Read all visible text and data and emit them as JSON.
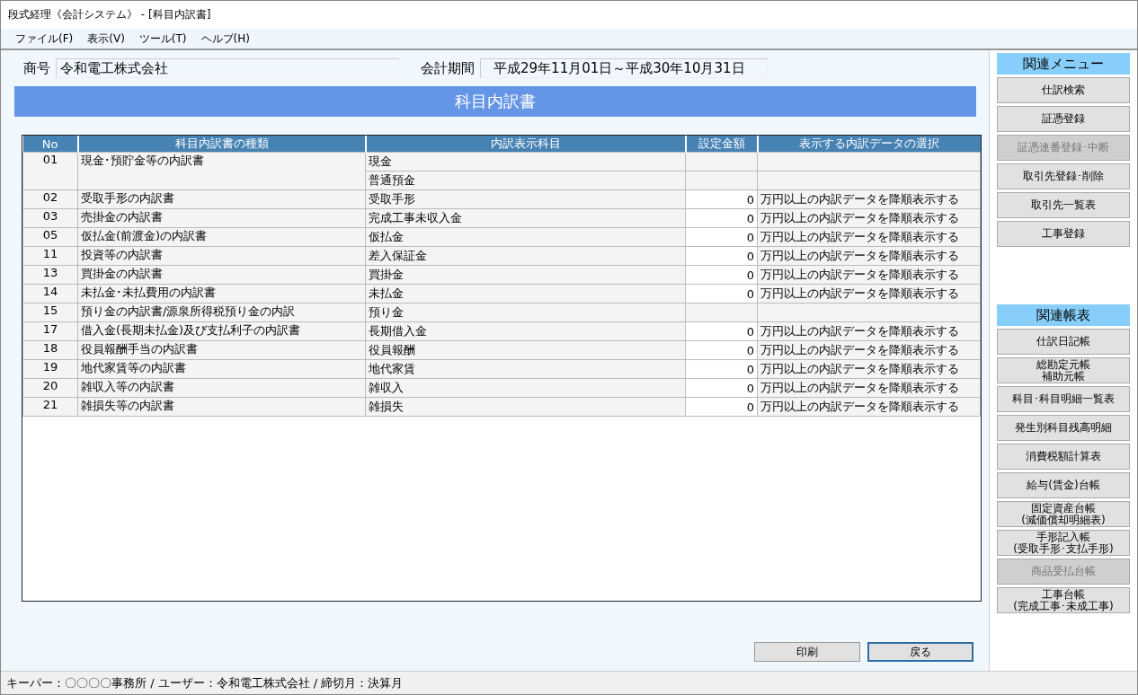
{
  "window": {
    "title": "段式経理《会計システム》 - [科目内訳書]"
  },
  "menu": [
    {
      "label": "ファイル(F)"
    },
    {
      "label": "表示(V)"
    },
    {
      "label": "ツール(T)"
    },
    {
      "label": "ヘルプ(H)"
    }
  ],
  "header": {
    "company_label": "商号",
    "company": "令和電工株式会社",
    "period_label": "会計期間",
    "period": "平成29年11月01日～平成30年10月31日"
  },
  "page_title": "科目内訳書",
  "table": {
    "columns": [
      "No",
      "科目内訳書の種類",
      "内訳表示科目",
      "設定金額",
      "表示する内訳データの選択"
    ],
    "rows": [
      {
        "no": "01",
        "statement": "現金･預貯金等の内訳書",
        "lines": [
          {
            "subject": "現金"
          },
          {
            "subject": "普通預金"
          }
        ]
      },
      {
        "no": "02",
        "statement": "受取手形の内訳書",
        "lines": [
          {
            "subject": "受取手形",
            "amount": "0",
            "selection": "万円以上の内訳データを降順表示する"
          }
        ]
      },
      {
        "no": "03",
        "statement": "売掛金の内訳書",
        "lines": [
          {
            "subject": "完成工事未収入金",
            "amount": "0",
            "selection": "万円以上の内訳データを降順表示する"
          }
        ]
      },
      {
        "no": "05",
        "statement": "仮払金(前渡金)の内訳書",
        "lines": [
          {
            "subject": "仮払金",
            "amount": "0",
            "selection": "万円以上の内訳データを降順表示する"
          }
        ]
      },
      {
        "no": "11",
        "statement": "投資等の内訳書",
        "lines": [
          {
            "subject": "差入保証金",
            "amount": "0",
            "selection": "万円以上の内訳データを降順表示する"
          }
        ]
      },
      {
        "no": "13",
        "statement": "買掛金の内訳書",
        "lines": [
          {
            "subject": "買掛金",
            "amount": "0",
            "selection": "万円以上の内訳データを降順表示する"
          }
        ]
      },
      {
        "no": "14",
        "statement": "未払金･未払費用の内訳書",
        "lines": [
          {
            "subject": "未払金",
            "amount": "0",
            "selection": "万円以上の内訳データを降順表示する"
          }
        ]
      },
      {
        "no": "15",
        "statement": "預り金の内訳書/源泉所得税預り金の内訳",
        "lines": [
          {
            "subject": "預り金"
          }
        ]
      },
      {
        "no": "17",
        "statement": "借入金(長期未払金)及び支払利子の内訳書",
        "lines": [
          {
            "subject": "長期借入金",
            "amount": "0",
            "selection": "万円以上の内訳データを降順表示する"
          }
        ]
      },
      {
        "no": "18",
        "statement": "役員報酬手当の内訳書",
        "lines": [
          {
            "subject": "役員報酬",
            "amount": "0",
            "selection": "万円以上の内訳データを降順表示する"
          }
        ]
      },
      {
        "no": "19",
        "statement": "地代家賃等の内訳書",
        "lines": [
          {
            "subject": "地代家賃",
            "amount": "0",
            "selection": "万円以上の内訳データを降順表示する"
          }
        ]
      },
      {
        "no": "20",
        "statement": "雑収入等の内訳書",
        "lines": [
          {
            "subject": "雑収入",
            "amount": "0",
            "selection": "万円以上の内訳データを降順表示する"
          }
        ]
      },
      {
        "no": "21",
        "statement": "雑損失等の内訳書",
        "lines": [
          {
            "subject": "雑損失",
            "amount": "0",
            "selection": "万円以上の内訳データを降順表示する"
          }
        ]
      }
    ]
  },
  "actions": [
    {
      "label": "印刷",
      "focused": false
    },
    {
      "label": "戻る",
      "focused": true
    }
  ],
  "sidebar": [
    {
      "heading": "関連メニュー",
      "items": [
        {
          "label": "仕訳検索",
          "disabled": false
        },
        {
          "label": "証憑登録",
          "disabled": false
        },
        {
          "label": "証憑連番登録･中断",
          "disabled": true
        },
        {
          "label": "取引先登録･削除",
          "disabled": false
        },
        {
          "label": "取引先一覧表",
          "disabled": false
        },
        {
          "label": "工事登録",
          "disabled": false
        }
      ]
    },
    {
      "heading": "関連帳表",
      "items": [
        {
          "label": "仕訳日記帳",
          "disabled": false
        },
        {
          "lines": [
            "総勘定元帳",
            "補助元帳"
          ],
          "disabled": false
        },
        {
          "label": "科目･科目明細一覧表",
          "disabled": false
        },
        {
          "label": "発生別科目残高明細",
          "disabled": false
        },
        {
          "label": "消費税額計算表",
          "disabled": false
        },
        {
          "label": "給与(賃金)台帳",
          "disabled": false
        },
        {
          "lines": [
            "固定資産台帳",
            "(減価償却明細表)"
          ],
          "disabled": false
        },
        {
          "lines": [
            "手形記入帳",
            "(受取手形･支払手形)"
          ],
          "disabled": false
        },
        {
          "label": "商品受払台帳",
          "disabled": true
        },
        {
          "lines": [
            "工事台帳",
            "(完成工事･未成工事)"
          ],
          "disabled": false
        }
      ]
    }
  ],
  "status_bar": "キーパー：〇〇〇〇事務所 / ユーザー：令和電工株式会社 / 締切月：決算月"
}
